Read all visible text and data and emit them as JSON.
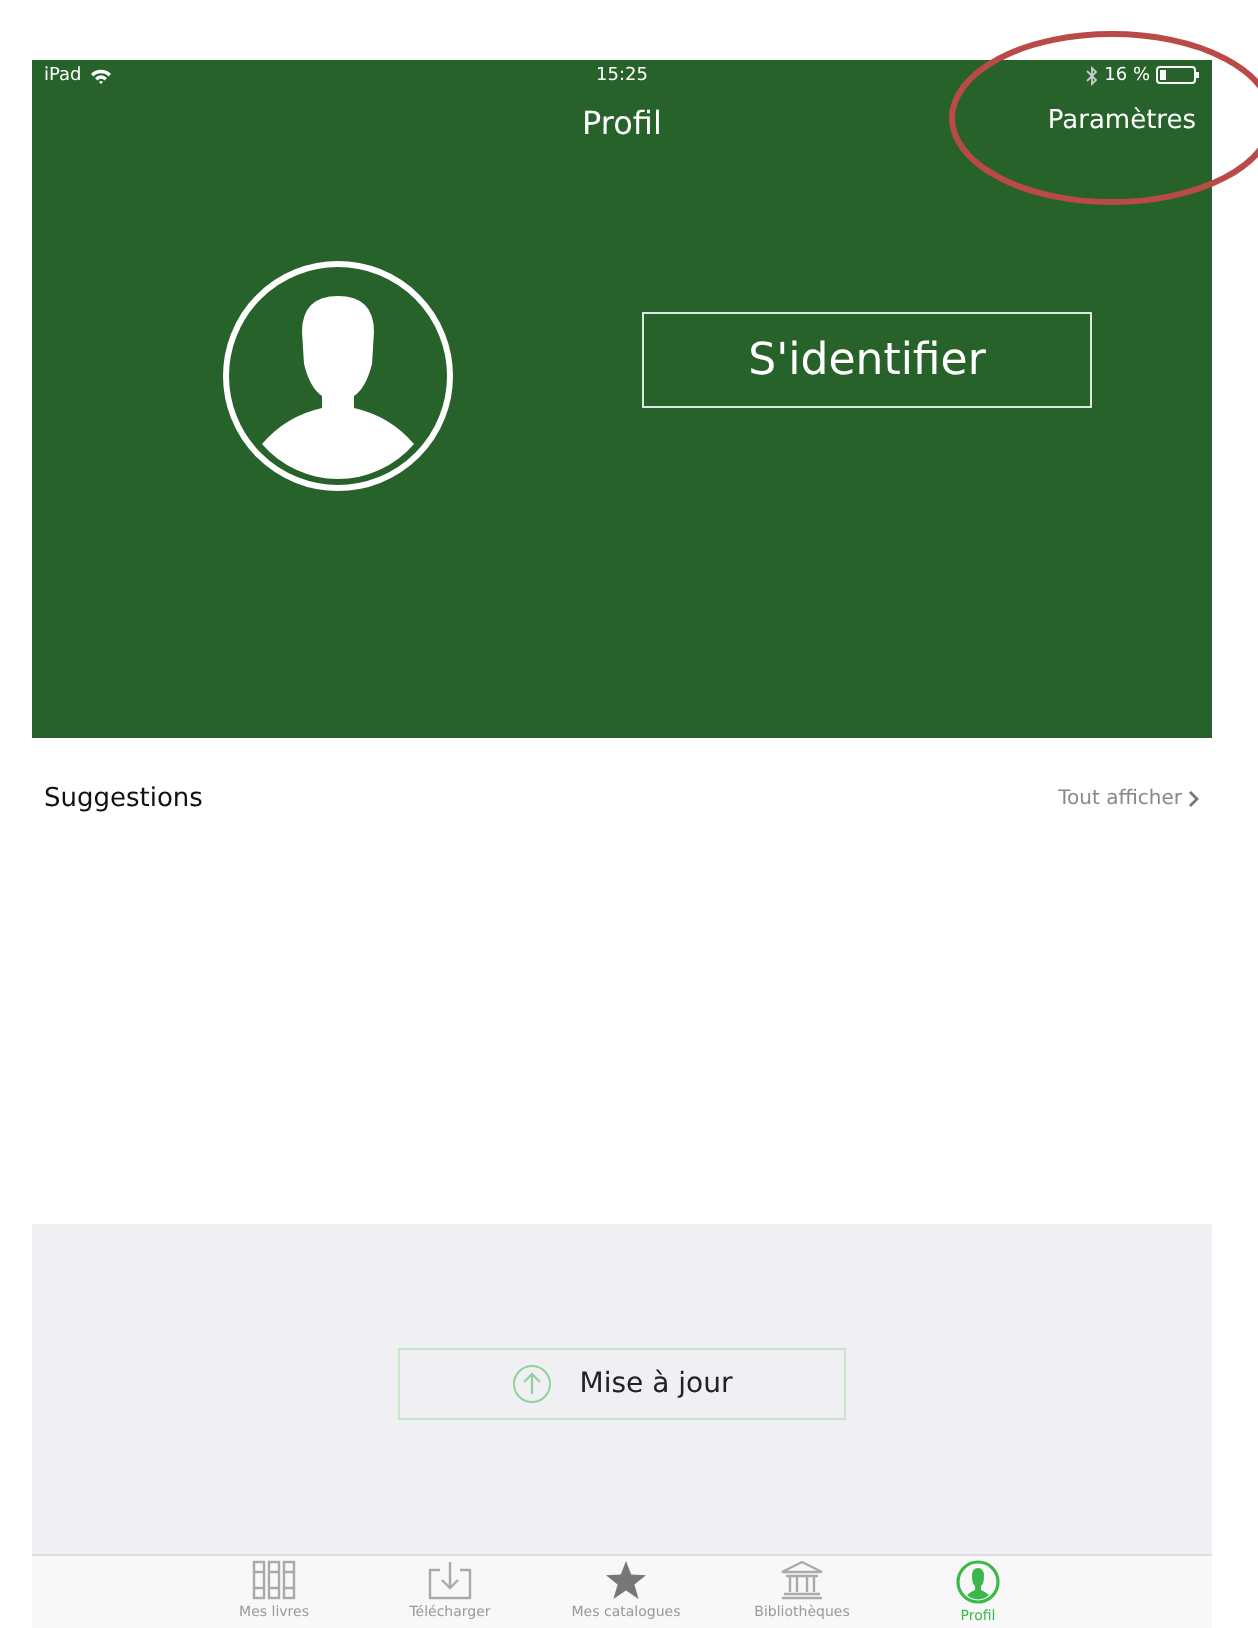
{
  "status_bar": {
    "device": "iPad",
    "time": "15:25",
    "battery": "16 %"
  },
  "nav_bar": {
    "title": "Profil",
    "action": "Paramètres"
  },
  "profile": {
    "login_button": "S'identifier"
  },
  "suggestions": {
    "title": "Suggestions",
    "see_all": "Tout afficher"
  },
  "update_button": "Mise à jour",
  "tabs": [
    {
      "label": "Mes livres",
      "kind": "books",
      "selected": false
    },
    {
      "label": "Télécharger",
      "kind": "download",
      "selected": false
    },
    {
      "label": "Mes catalogues",
      "kind": "star",
      "selected": false
    },
    {
      "label": "Bibliothèques",
      "kind": "library",
      "selected": false
    },
    {
      "label": "Profil",
      "kind": "profile",
      "selected": true
    }
  ]
}
